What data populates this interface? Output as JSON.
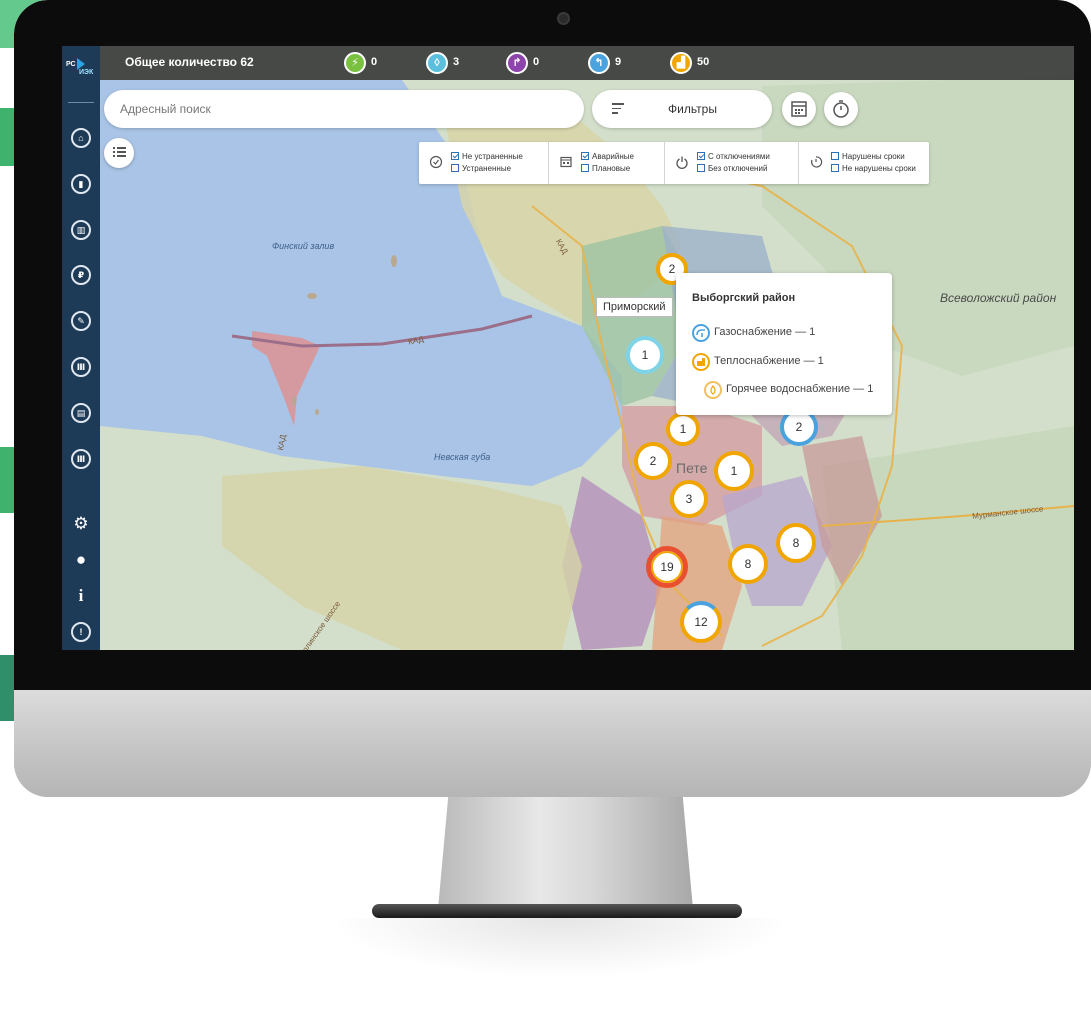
{
  "topbar": {
    "total": "Общее количество 62",
    "counters": [
      {
        "icon": "lightning-icon",
        "value": "0",
        "color": "#7ac142"
      },
      {
        "icon": "water-drop-icon",
        "value": "3",
        "color": "#5bc0de"
      },
      {
        "icon": "sewer-icon",
        "value": "0",
        "color": "#8e44ad"
      },
      {
        "icon": "gas-icon",
        "value": "9",
        "color": "#4aa3df"
      },
      {
        "icon": "heating-icon",
        "value": "50",
        "color": "#f0a500"
      }
    ]
  },
  "search": {
    "placeholder": "Адресный поиск"
  },
  "filters": {
    "label": "Фильтры"
  },
  "filter_panel": {
    "groups": [
      {
        "icon": "check-circle-icon",
        "options": [
          {
            "label": "Не устраненные",
            "checked": true
          },
          {
            "label": "Устраненные",
            "checked": false
          }
        ]
      },
      {
        "icon": "calendar-icon",
        "options": [
          {
            "label": "Аварийные",
            "checked": true
          },
          {
            "label": "Плановые",
            "checked": false
          }
        ]
      },
      {
        "icon": "power-icon",
        "options": [
          {
            "label": "С отключениями",
            "checked": true
          },
          {
            "label": "Без отключений",
            "checked": false
          }
        ]
      },
      {
        "icon": "timer-icon",
        "options": [
          {
            "label": "Нарушены сроки",
            "checked": false
          },
          {
            "label": "Не нарушены сроки",
            "checked": false
          }
        ]
      }
    ]
  },
  "map": {
    "labels": {
      "finsky": "Финский залив",
      "nevskaya": "Невская губа",
      "vsevolozhsky": "Всеволожский район",
      "peter": "Пете",
      "kad1": "КАД",
      "kad2": "КАД",
      "kad3": "КАД",
      "murmansk": "Мурманское шоссе",
      "shosse": "Таллинское шоссе"
    },
    "clusters": [
      "2",
      "1",
      "1",
      "2",
      "1",
      "3",
      "2",
      "19",
      "8",
      "8",
      "12"
    ],
    "tooltip": "Приморский"
  },
  "popup": {
    "title": "Выборгский район",
    "rows": [
      {
        "icon": "gas-icon",
        "text": "Газоснабжение — 1"
      },
      {
        "icon": "heating-icon",
        "text": "Теплоснабжение — 1"
      },
      {
        "icon": "hot-water-icon",
        "text": "Горячее водоснабжение — 1"
      }
    ]
  },
  "sidebar": {
    "logo_top": "РС",
    "logo_bottom": "ИЭК"
  }
}
